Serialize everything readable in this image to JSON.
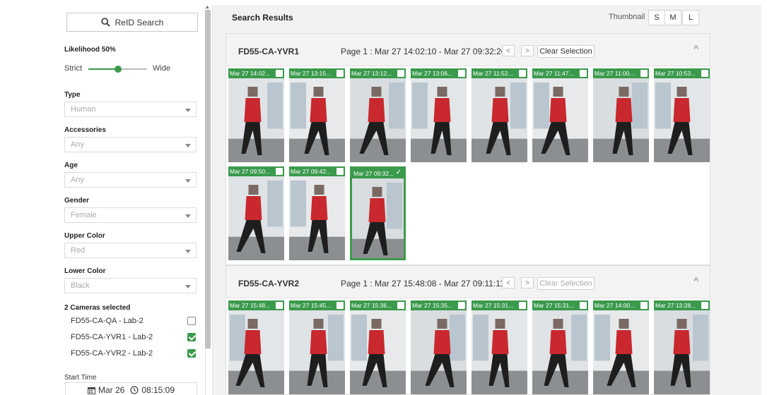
{
  "left_panel": {
    "reid_button_label": "ReID Search",
    "likelihood_label": "Likelihood 50%",
    "likelihood_value": 0.5,
    "slider_left_label": "Strict",
    "slider_right_label": "Wide",
    "filters": [
      {
        "label": "Type",
        "value": "Human"
      },
      {
        "label": "Accessories",
        "value": "Any"
      },
      {
        "label": "Age",
        "value": "Any"
      },
      {
        "label": "Gender",
        "value": "Female"
      },
      {
        "label": "Upper Color",
        "value": "Red"
      },
      {
        "label": "Lower Color",
        "value": "Black"
      }
    ],
    "cameras_label": "2 Cameras selected",
    "cameras": [
      {
        "name": "FD55-CA-QA - Lab-2",
        "checked": false
      },
      {
        "name": "FD55-CA-YVR1 - Lab-2",
        "checked": true
      },
      {
        "name": "FD55-CA-YVR2 - Lab-2",
        "checked": true
      }
    ],
    "start_time_label": "Start Time",
    "start_date": "Mar 26",
    "start_time": "08:15:09"
  },
  "results": {
    "title": "Search Results",
    "thumbnail_label": "Thumbnail",
    "sizes": [
      "S",
      "M",
      "L"
    ],
    "groups": [
      {
        "camera": "FD55-CA-YVR1",
        "page_info": "Page 1 : Mar 27 14:02:10 - Mar 27 09:32:26",
        "prev_label": "<",
        "next_label": ">",
        "clear_label": "Clear Selection",
        "collapse_icon": "^",
        "thumbs": [
          {
            "ts": "Mar 27 14:02...",
            "selected": false
          },
          {
            "ts": "Mar 27 13:15...",
            "selected": false
          },
          {
            "ts": "Mar 27 13:12...",
            "selected": false
          },
          {
            "ts": "Mar 27 13:06...",
            "selected": false
          },
          {
            "ts": "Mar 27 11:52...",
            "selected": false
          },
          {
            "ts": "Mar 27 11:47...",
            "selected": false
          },
          {
            "ts": "Mar 27 11:00...",
            "selected": false
          },
          {
            "ts": "Mar 27 10:53...",
            "selected": false
          },
          {
            "ts": "Mar 27 09:50...",
            "selected": false
          },
          {
            "ts": "Mar 27 09:42...",
            "selected": false
          },
          {
            "ts": "Mar 27 09:32...",
            "selected": true
          }
        ]
      },
      {
        "camera": "FD55-CA-YVR2",
        "page_info": "Page 1 : Mar 27 15:48:08 - Mar 27 09:11:11",
        "prev_label": "<",
        "next_label": ">",
        "clear_label": "Clear Selection",
        "collapse_icon": "^",
        "thumbs": [
          {
            "ts": "Mar 27 15:48...",
            "selected": false
          },
          {
            "ts": "Mar 27 15:45...",
            "selected": false
          },
          {
            "ts": "Mar 27 15:36...",
            "selected": false
          },
          {
            "ts": "Mar 27 15:35...",
            "selected": false
          },
          {
            "ts": "Mar 27 15:31...",
            "selected": false
          },
          {
            "ts": "Mar 27 15:31...",
            "selected": false
          },
          {
            "ts": "Mar 27 14:00...",
            "selected": false
          },
          {
            "ts": "Mar 27 13:28...",
            "selected": false
          }
        ]
      }
    ]
  },
  "colors": {
    "accent": "#3a9a4c",
    "shirt": "#c8282e",
    "pants": "#1e1e1e"
  }
}
